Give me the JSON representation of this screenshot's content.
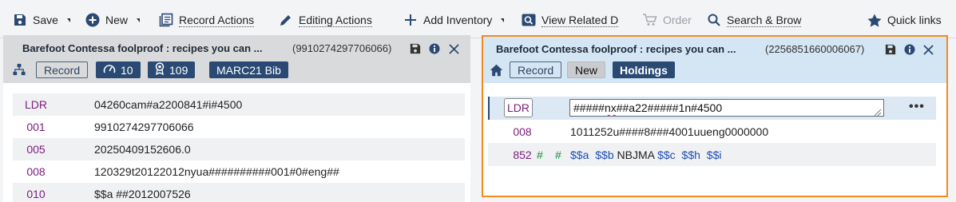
{
  "toolbar": {
    "save": "Save",
    "new": "New",
    "record_actions": "Record Actions",
    "editing_actions": "Editing Actions",
    "add_inventory": "Add Inventory",
    "view_related": "View Related D",
    "order": "Order",
    "search_browse": "Search & Brow",
    "quick_links": "Quick links"
  },
  "left": {
    "title": "Barefoot Contessa foolproof : recipes you can ...",
    "record_id": "(9910274297706066)",
    "badges": {
      "record": "Record",
      "count_a": "10",
      "count_b": "109",
      "format": "MARC21 Bib"
    },
    "rows": [
      {
        "tag": "LDR",
        "value": "04260cam#a2200841#i#4500"
      },
      {
        "tag": "001",
        "value": "9910274297706066"
      },
      {
        "tag": "005",
        "value": "20250409152606.0"
      },
      {
        "tag": "008",
        "value": "120329t20122012nyua##########001#0#eng##"
      },
      {
        "tag": "010",
        "value": "$$a ##2012007526"
      }
    ]
  },
  "right": {
    "title": "Barefoot Contessa foolproof : recipes you can ...",
    "record_id": "(2256851660006067)",
    "badges": {
      "record": "Record",
      "new": "New",
      "holdings": "Holdings"
    },
    "ldr_tag": "LDR",
    "ldr_value_pre": "#####",
    "ldr_value_squiggle": "nx",
    "ldr_value_post": "##a22#####1n#4500",
    "rows": [
      {
        "tag": "008",
        "value": "1011252u####8###4001uueng0000000"
      }
    ],
    "field852": {
      "tag": "852",
      "ind1": "#",
      "ind2": "#",
      "sf_a": "$$a",
      "sf_b": "$$b",
      "b_value": "NBJMA",
      "sf_c": "$$c",
      "sf_h": "$$h",
      "sf_i": "$$i"
    }
  },
  "colors": {
    "accent": "#2a4a73",
    "highlight_border": "#f28a1f",
    "tag": "#7b1c7d"
  }
}
